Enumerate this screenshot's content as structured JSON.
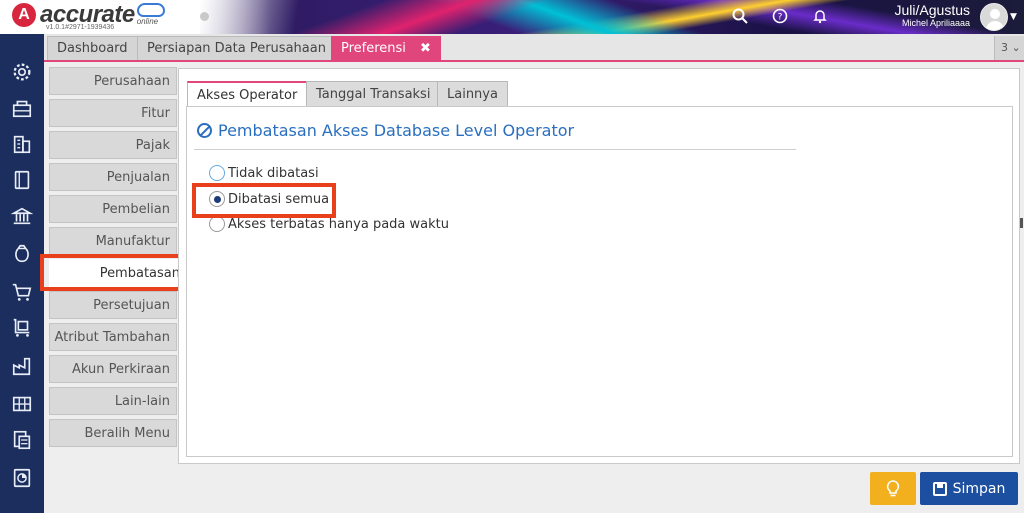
{
  "app": {
    "logo_mark": "A",
    "logo_text": "accurate",
    "logo_sub": "online",
    "version": "v1.0.1#2971-1939436"
  },
  "header": {
    "period": "Juli/Agustus",
    "user_name": "Michel Apriliaaaa",
    "icons": [
      "search-icon",
      "help-icon",
      "bell-icon"
    ]
  },
  "main_tabs": [
    {
      "label": "Dashboard"
    },
    {
      "label": "Persiapan Data Perusahaan"
    },
    {
      "label": "Preferensi",
      "close": "✖"
    }
  ],
  "tab_counter": "3 ⌄",
  "left_nav": [
    {
      "label": "Perusahaan"
    },
    {
      "label": "Fitur"
    },
    {
      "label": "Pajak"
    },
    {
      "label": "Penjualan"
    },
    {
      "label": "Pembelian"
    },
    {
      "label": "Manufaktur"
    },
    {
      "label": "Pembatasan"
    },
    {
      "label": "Persetujuan"
    },
    {
      "label": "Atribut Tambahan"
    },
    {
      "label": "Akun Perkiraan"
    },
    {
      "label": "Lain-lain"
    },
    {
      "label": "Beralih Menu"
    }
  ],
  "inner_tabs": [
    {
      "label": "Akses Operator"
    },
    {
      "label": "Tanggal Transaksi"
    },
    {
      "label": "Lainnya"
    }
  ],
  "section": {
    "title": "Pembatasan Akses Database Level Operator",
    "options": [
      {
        "label": "Tidak dibatasi",
        "checked": false
      },
      {
        "label": "Dibatasi semua",
        "checked": true
      },
      {
        "label": "Akses terbatas hanya pada waktu",
        "checked": false
      }
    ]
  },
  "buttons": {
    "save_label": "Simpan",
    "bulb_icon": "lightbulb-icon"
  },
  "colors": {
    "accent": "#e0457b",
    "sidebar": "#1c2e5e",
    "primary": "#1c4fa0",
    "warning": "#f2b01e",
    "highlight": "#e8401c",
    "title": "#2a6fbf"
  }
}
